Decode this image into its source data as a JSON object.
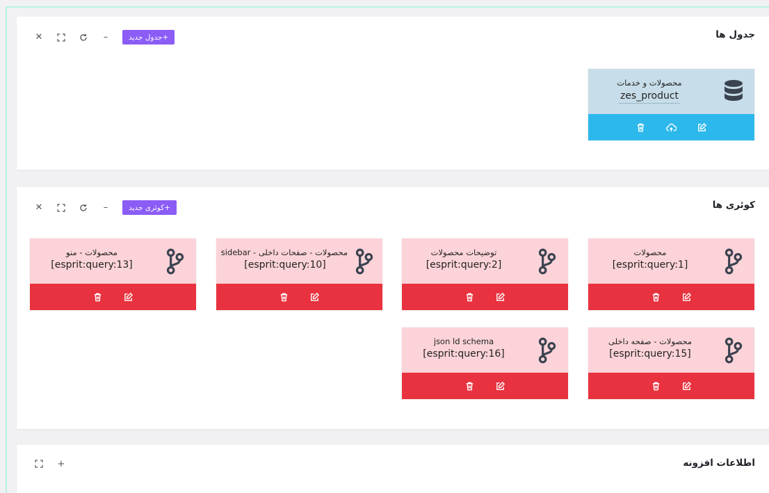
{
  "colors": {
    "accent_purple": "#8b5cf6",
    "table_card_bg": "#c7dde9",
    "table_card_actions": "#2db8ec",
    "query_card_bg": "#fcd3d8",
    "query_card_actions": "#e8323f"
  },
  "tables_panel": {
    "title": "جدول ها",
    "add_label": "+جدول جدید",
    "tools": [
      "close-icon",
      "fullscreen-icon",
      "refresh-icon",
      "minimize-icon"
    ],
    "cards": [
      {
        "title": "محصولات و خدمات",
        "subtitle": "zes_product",
        "icon": "database-icon",
        "actions": [
          "delete-icon",
          "upload-icon",
          "edit-icon"
        ]
      }
    ]
  },
  "queries_panel": {
    "title": "کوئری ها",
    "add_label": "+کوئری جدید",
    "tools": [
      "close-icon",
      "fullscreen-icon",
      "refresh-icon",
      "minimize-icon"
    ],
    "cards": [
      {
        "title": "محصولات",
        "subtitle": "[esprit:query:1]",
        "icon": "branch-icon"
      },
      {
        "title": "توضیحات محصولات",
        "subtitle": "[esprit:query:2]",
        "icon": "branch-icon"
      },
      {
        "title": "محصولات - صفحات داخلی - sidebar",
        "subtitle": "[esprit:query:10]",
        "icon": "branch-icon"
      },
      {
        "title": "محصولات - منو",
        "subtitle": "[esprit:query:13]",
        "icon": "branch-icon"
      },
      {
        "title": "محصولات - صفحه داخلی",
        "subtitle": "[esprit:query:15]",
        "icon": "branch-icon"
      },
      {
        "title": "json ld schema",
        "subtitle": "[esprit:query:16]",
        "icon": "branch-icon"
      }
    ]
  },
  "extras_panel": {
    "title": "اطلاعات افزونه",
    "tools": [
      "fullscreen-icon",
      "plus-icon"
    ]
  }
}
